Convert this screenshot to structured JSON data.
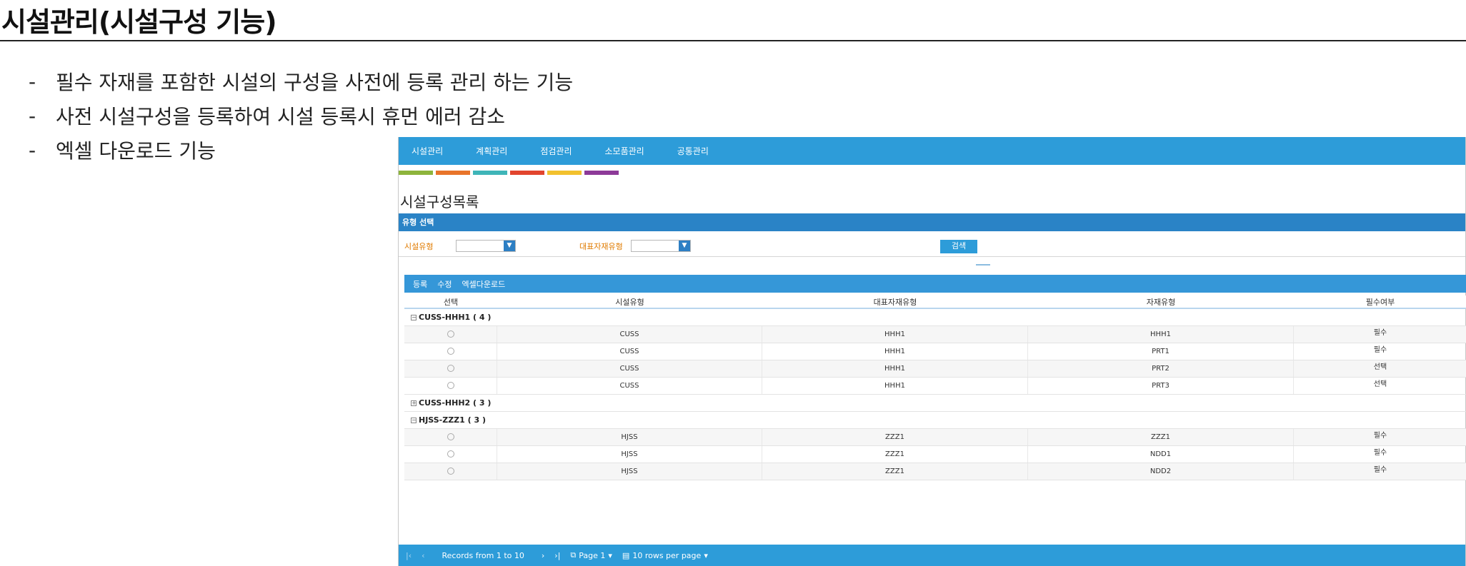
{
  "slide": {
    "title": "시설관리(시설구성 기능)",
    "bullets": [
      "필수 자재를 포함한 시설의 구성을 사전에 등록 관리 하는 기능",
      "사전 시설구성을 등록하여 시설 등록시 휴먼 에러 감소",
      "엑셀 다운로드 기능"
    ]
  },
  "app": {
    "nav": [
      "시설관리",
      "계획관리",
      "점검관리",
      "소모품관리",
      "공통관리"
    ],
    "strip_colors": [
      "#8db43c",
      "#e8742a",
      "#3fb5b8",
      "#e2452e",
      "#f2c12e",
      "#8d3a98"
    ],
    "page_title": "시설구성목록",
    "filter": {
      "bar_title": "유형 선택",
      "facility_type_label": "시설유형",
      "material_type_label": "대표자재유형",
      "search_label": "검색"
    },
    "toolbar": [
      "등록",
      "수정",
      "엑셀다운로드"
    ],
    "grid": {
      "columns": [
        "선택",
        "시설유형",
        "대표자재유형",
        "자재유형",
        "필수여부"
      ],
      "groups": [
        {
          "label": "CUSS-HHH1 ( 4 )",
          "toggle": "−",
          "rows": [
            [
              "CUSS",
              "HHH1",
              "HHH1",
              "필수"
            ],
            [
              "CUSS",
              "HHH1",
              "PRT1",
              "필수"
            ],
            [
              "CUSS",
              "HHH1",
              "PRT2",
              "선택"
            ],
            [
              "CUSS",
              "HHH1",
              "PRT3",
              "선택"
            ]
          ]
        },
        {
          "label": "CUSS-HHH2 ( 3 )",
          "toggle": "+",
          "rows": []
        },
        {
          "label": "HJSS-ZZZ1 ( 3 )",
          "toggle": "−",
          "rows": [
            [
              "HJSS",
              "ZZZ1",
              "ZZZ1",
              "필수"
            ],
            [
              "HJSS",
              "ZZZ1",
              "NDD1",
              "필수"
            ],
            [
              "HJSS",
              "ZZZ1",
              "NDD2",
              "필수"
            ]
          ]
        }
      ]
    },
    "footer": {
      "first": "|‹",
      "prev": "‹",
      "records": "Records from 1 to 10",
      "next": "›",
      "last": "›|",
      "page_icon": "⧉",
      "page": "Page 1",
      "page_caret": "▾",
      "rows_icon": "▤",
      "rows_per_page": "10 rows per page",
      "rows_caret": "▾"
    }
  }
}
